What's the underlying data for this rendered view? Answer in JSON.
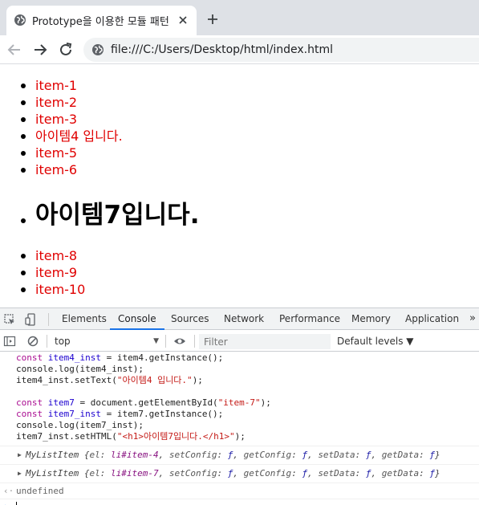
{
  "browser": {
    "tab_title": "Prototype을 이용한 모듈 패턴",
    "url": "file:///C:/Users/Desktop/html/index.html"
  },
  "page": {
    "items_top": [
      "item-1",
      "item-2",
      "item-3",
      "아이템4 입니다.",
      "item-5",
      "item-6"
    ],
    "item7_heading": "아이템7입니다.",
    "items_bottom": [
      "item-8",
      "item-9",
      "item-10"
    ],
    "item_color": "#e00000"
  },
  "devtools": {
    "tabs": [
      "Elements",
      "Console",
      "Sources",
      "Network",
      "Performance",
      "Memory",
      "Application"
    ],
    "active_tab": "Console",
    "context": "top",
    "filter_placeholder": "Filter",
    "levels_label": "Default levels ▼",
    "code": [
      "const item4_inst = item4.getInstance();",
      "console.log(item4_inst);",
      "item4_inst.setText(\"아이템4 입니다.\");",
      "",
      "const item7 = document.getElementById(\"item-7\");",
      "const item7_inst = item7.getInstance();",
      "console.log(item7_inst);",
      "item7_inst.setHTML(\"<h1>아이템7입니다.</h1>\");"
    ],
    "logs": [
      "MyListItem {el: li#item-4, setConfig: ƒ, getConfig: ƒ, setData: ƒ, getData: ƒ}",
      "MyListItem {el: li#item-7, setConfig: ƒ, getConfig: ƒ, setData: ƒ, getData: ƒ}"
    ],
    "result": "undefined"
  }
}
